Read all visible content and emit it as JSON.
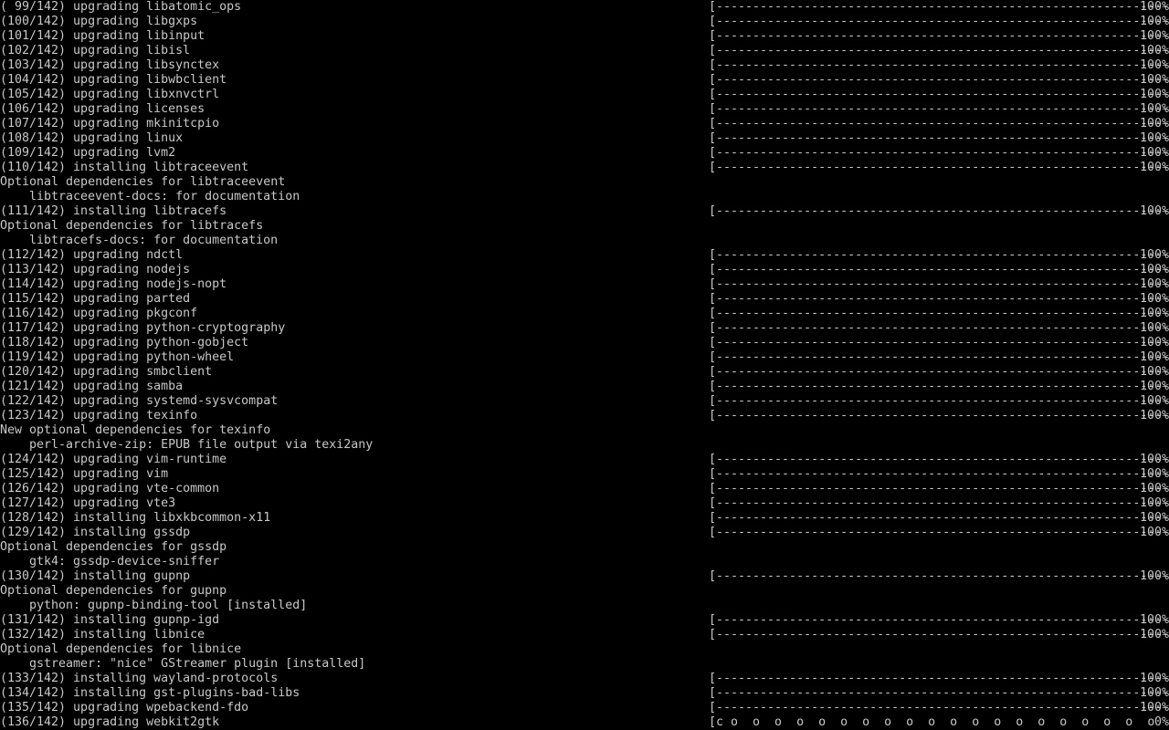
{
  "colors": {
    "background": "#000000",
    "foreground": "#c8c8c8"
  },
  "terminal": {
    "lines": [
      {
        "text": "( 99/142) upgrading libatomic_ops",
        "bar": "[------------------------------------------------------------------]",
        "pct": "100%"
      },
      {
        "text": "(100/142) upgrading libgxps",
        "bar": "[------------------------------------------------------------------]",
        "pct": "100%"
      },
      {
        "text": "(101/142) upgrading libinput",
        "bar": "[------------------------------------------------------------------]",
        "pct": "100%"
      },
      {
        "text": "(102/142) upgrading libisl",
        "bar": "[------------------------------------------------------------------]",
        "pct": "100%"
      },
      {
        "text": "(103/142) upgrading libsynctex",
        "bar": "[------------------------------------------------------------------]",
        "pct": "100%"
      },
      {
        "text": "(104/142) upgrading libwbclient",
        "bar": "[------------------------------------------------------------------]",
        "pct": "100%"
      },
      {
        "text": "(105/142) upgrading libxnvctrl",
        "bar": "[------------------------------------------------------------------]",
        "pct": "100%"
      },
      {
        "text": "(106/142) upgrading licenses",
        "bar": "[------------------------------------------------------------------]",
        "pct": "100%"
      },
      {
        "text": "(107/142) upgrading mkinitcpio",
        "bar": "[------------------------------------------------------------------]",
        "pct": "100%"
      },
      {
        "text": "(108/142) upgrading linux",
        "bar": "[------------------------------------------------------------------]",
        "pct": "100%"
      },
      {
        "text": "(109/142) upgrading lvm2",
        "bar": "[------------------------------------------------------------------]",
        "pct": "100%"
      },
      {
        "text": "(110/142) installing libtraceevent",
        "bar": "[------------------------------------------------------------------]",
        "pct": "100%"
      },
      {
        "text": "Optional dependencies for libtraceevent"
      },
      {
        "text": "libtraceevent-docs: for documentation",
        "indent": true
      },
      {
        "text": "(111/142) installing libtracefs",
        "bar": "[------------------------------------------------------------------]",
        "pct": "100%"
      },
      {
        "text": "Optional dependencies for libtracefs"
      },
      {
        "text": "libtracefs-docs: for documentation",
        "indent": true
      },
      {
        "text": "(112/142) upgrading ndctl",
        "bar": "[------------------------------------------------------------------]",
        "pct": "100%"
      },
      {
        "text": "(113/142) upgrading nodejs",
        "bar": "[------------------------------------------------------------------]",
        "pct": "100%"
      },
      {
        "text": "(114/142) upgrading nodejs-nopt",
        "bar": "[------------------------------------------------------------------]",
        "pct": "100%"
      },
      {
        "text": "(115/142) upgrading parted",
        "bar": "[------------------------------------------------------------------]",
        "pct": "100%"
      },
      {
        "text": "(116/142) upgrading pkgconf",
        "bar": "[------------------------------------------------------------------]",
        "pct": "100%"
      },
      {
        "text": "(117/142) upgrading python-cryptography",
        "bar": "[------------------------------------------------------------------]",
        "pct": "100%"
      },
      {
        "text": "(118/142) upgrading python-gobject",
        "bar": "[------------------------------------------------------------------]",
        "pct": "100%"
      },
      {
        "text": "(119/142) upgrading python-wheel",
        "bar": "[------------------------------------------------------------------]",
        "pct": "100%"
      },
      {
        "text": "(120/142) upgrading smbclient",
        "bar": "[------------------------------------------------------------------]",
        "pct": "100%"
      },
      {
        "text": "(121/142) upgrading samba",
        "bar": "[------------------------------------------------------------------]",
        "pct": "100%"
      },
      {
        "text": "(122/142) upgrading systemd-sysvcompat",
        "bar": "[------------------------------------------------------------------]",
        "pct": "100%"
      },
      {
        "text": "(123/142) upgrading texinfo",
        "bar": "[------------------------------------------------------------------]",
        "pct": "100%"
      },
      {
        "text": "New optional dependencies for texinfo"
      },
      {
        "text": "perl-archive-zip: EPUB file output via texi2any",
        "indent": true
      },
      {
        "text": "(124/142) upgrading vim-runtime",
        "bar": "[------------------------------------------------------------------]",
        "pct": "100%"
      },
      {
        "text": "(125/142) upgrading vim",
        "bar": "[------------------------------------------------------------------]",
        "pct": "100%"
      },
      {
        "text": "(126/142) upgrading vte-common",
        "bar": "[------------------------------------------------------------------]",
        "pct": "100%"
      },
      {
        "text": "(127/142) upgrading vte3",
        "bar": "[------------------------------------------------------------------]",
        "pct": "100%"
      },
      {
        "text": "(128/142) installing libxkbcommon-x11",
        "bar": "[------------------------------------------------------------------]",
        "pct": "100%"
      },
      {
        "text": "(129/142) installing gssdp",
        "bar": "[------------------------------------------------------------------]",
        "pct": "100%"
      },
      {
        "text": "Optional dependencies for gssdp"
      },
      {
        "text": "gtk4: gssdp-device-sniffer",
        "indent": true
      },
      {
        "text": "(130/142) installing gupnp",
        "bar": "[------------------------------------------------------------------]",
        "pct": "100%"
      },
      {
        "text": "Optional dependencies for gupnp"
      },
      {
        "text": "python: gupnp-binding-tool [installed]",
        "indent": true
      },
      {
        "text": "(131/142) installing gupnp-igd",
        "bar": "[------------------------------------------------------------------]",
        "pct": "100%"
      },
      {
        "text": "(132/142) installing libnice",
        "bar": "[------------------------------------------------------------------]",
        "pct": "100%"
      },
      {
        "text": "Optional dependencies for libnice"
      },
      {
        "text": "gstreamer: \"nice\" GStreamer plugin [installed]",
        "indent": true
      },
      {
        "text": "(133/142) installing wayland-protocols",
        "bar": "[------------------------------------------------------------------]",
        "pct": "100%"
      },
      {
        "text": "(134/142) installing gst-plugins-bad-libs",
        "bar": "[------------------------------------------------------------------]",
        "pct": "100%"
      },
      {
        "text": "(135/142) upgrading wpebackend-fdo",
        "bar": "[------------------------------------------------------------------]",
        "pct": "100%"
      },
      {
        "text": "(136/142) upgrading webkit2gtk",
        "bar": "[c o  o  o  o  o  o  o  o  o  o  o  o  o  o  o  o  o  o  o  o  o ]",
        "pct": "0%"
      }
    ]
  }
}
